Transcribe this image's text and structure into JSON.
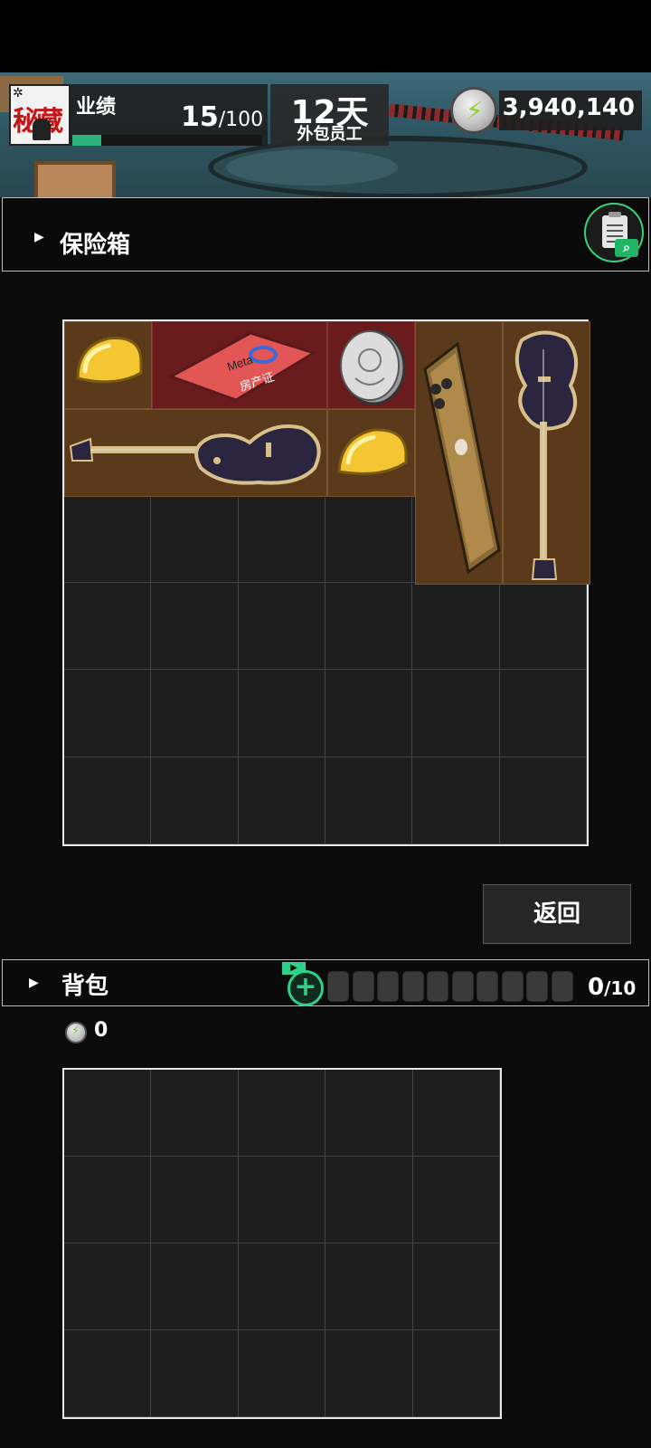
{
  "header": {
    "avatar_seal": "秘藏",
    "performance_label": "业绩",
    "performance_current": "15",
    "performance_total": "/100",
    "performance_progress": 0.15,
    "days": "12天",
    "role": "外包员工",
    "currency_amount": "3,940,140"
  },
  "safe": {
    "title": "保险箱",
    "columns": 6,
    "rows": 6,
    "items": [
      {
        "name": "cheese-item",
        "icon": "cheese-wedge",
        "color": "#f2c12e"
      },
      {
        "name": "meta-property-card-item",
        "icon": "property-certificate",
        "card_brand": "Meta",
        "card_text": "房产证",
        "color": "#e05050"
      },
      {
        "name": "silver-coin-item",
        "icon": "silver-coin",
        "color": "#cfcfcf"
      },
      {
        "name": "smartphone-item",
        "icon": "gold-smartphone",
        "color": "#8a6a35"
      },
      {
        "name": "electric-guitar-vertical-item",
        "icon": "electric-guitar",
        "color": "#2b2540"
      },
      {
        "name": "electric-guitar-horizontal-item",
        "icon": "electric-guitar",
        "color": "#2b2540"
      },
      {
        "name": "cheese-item-2",
        "icon": "cheese-wedge",
        "color": "#f2c12e"
      }
    ]
  },
  "back_button": "返回",
  "backpack": {
    "title": "背包",
    "capacity_used": "0",
    "capacity_total": "/10",
    "slots": 10,
    "coins": "0",
    "columns": 5,
    "rows": 4
  },
  "colors": {
    "accent_green": "#2fd08a",
    "item_brown": "#5a3a1a",
    "item_red": "#6a1c1c"
  }
}
